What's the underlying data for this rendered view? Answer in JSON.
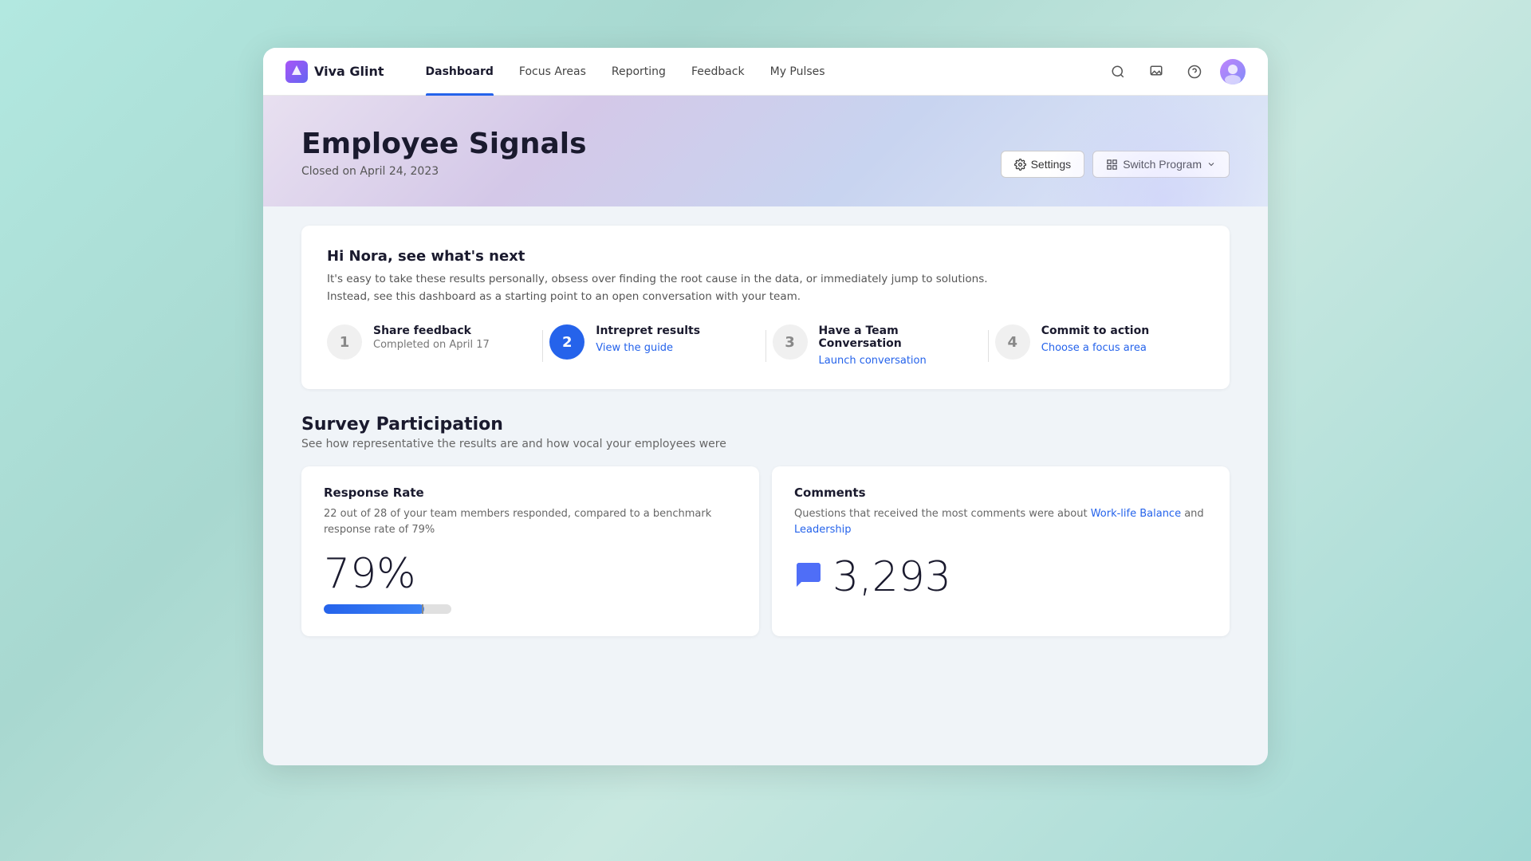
{
  "app": {
    "logo_text": "Viva Glint"
  },
  "nav": {
    "links": [
      {
        "label": "Dashboard",
        "active": true
      },
      {
        "label": "Focus Areas",
        "active": false
      },
      {
        "label": "Reporting",
        "active": false
      },
      {
        "label": "Feedback",
        "active": false
      },
      {
        "label": "My Pulses",
        "active": false
      }
    ]
  },
  "hero": {
    "title": "Employee Signals",
    "subtitle": "Closed on April 24, 2023",
    "settings_btn": "Settings",
    "switch_btn": "Switch Program"
  },
  "whats_next": {
    "title": "Hi Nora, see what's next",
    "desc1": "It's easy to take these results personally, obsess over finding the root cause in the data, or immediately jump to solutions.",
    "desc2": "Instead, see this dashboard as a starting point to an open conversation with your team.",
    "steps": [
      {
        "number": "1",
        "active": false,
        "label": "Share feedback",
        "sublabel": "Completed on April 17",
        "link": null
      },
      {
        "number": "2",
        "active": true,
        "label": "Intrepret results",
        "sublabel": null,
        "link": "View the guide"
      },
      {
        "number": "3",
        "active": false,
        "label": "Have a Team Conversation",
        "sublabel": null,
        "link": "Launch conversation"
      },
      {
        "number": "4",
        "active": false,
        "label": "Commit to action",
        "sublabel": null,
        "link": "Choose a focus area"
      }
    ]
  },
  "survey": {
    "section_title": "Survey Participation",
    "section_desc": "See how representative the results are and how vocal your employees were",
    "response_rate": {
      "label": "Response Rate",
      "desc": "22 out of 28 of your team members responded, compared to a benchmark response rate of 79%",
      "value": "79%",
      "bar_fill_pct": 79
    },
    "comments": {
      "label": "Comments",
      "desc_prefix": "Questions that received the most comments were about ",
      "link1": "Work-life Balance",
      "desc_mid": " and ",
      "link2": "Leadership",
      "value": "3,293"
    }
  }
}
